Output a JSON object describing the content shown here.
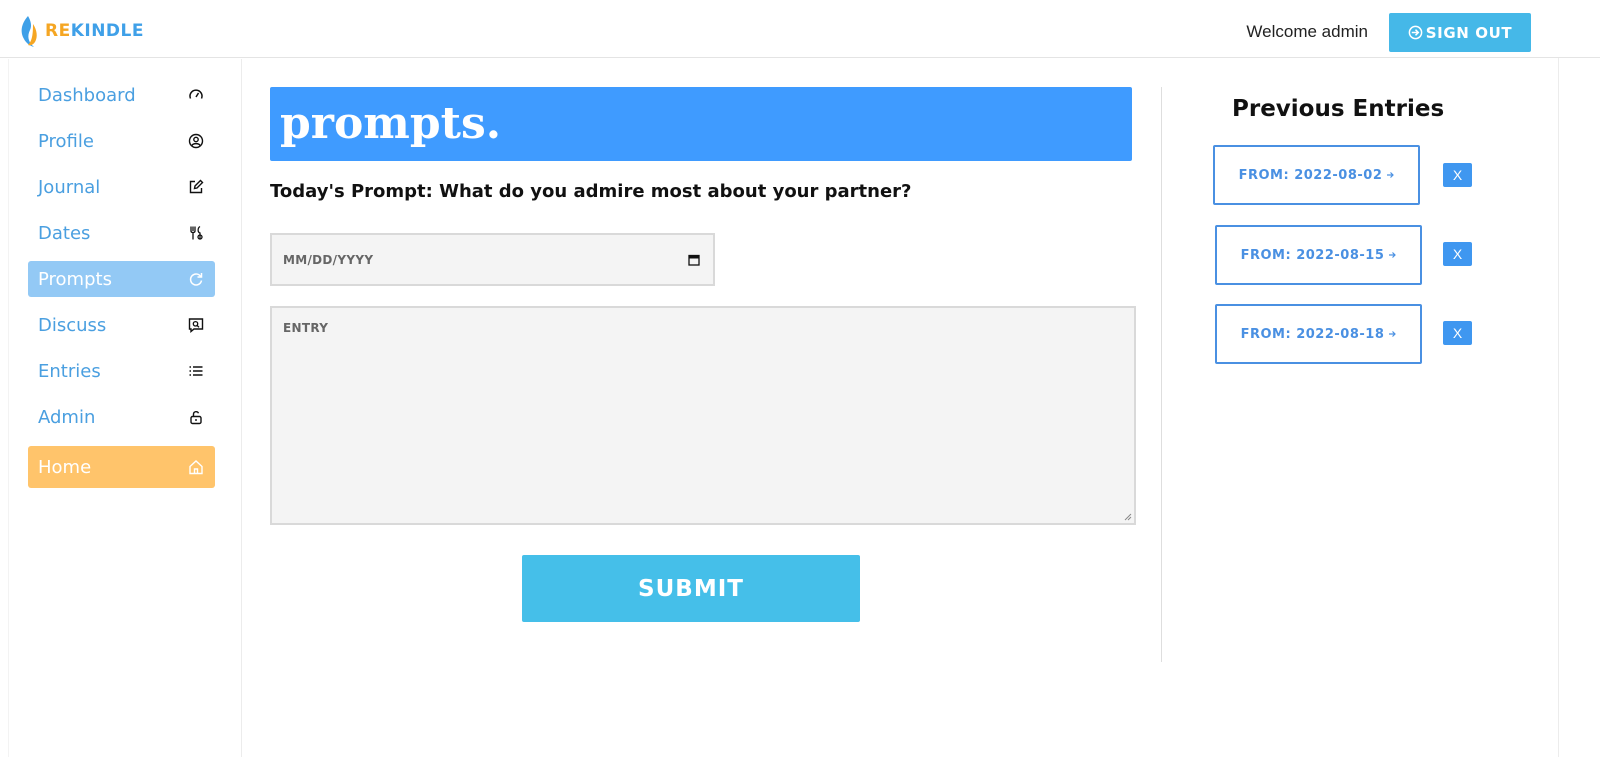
{
  "header": {
    "logo_re": "RE",
    "logo_kindle": "KINDLE",
    "welcome": "Welcome admin",
    "signout_label": "SIGN OUT"
  },
  "sidebar": {
    "items": [
      {
        "label": "Dashboard",
        "icon": "gauge-icon"
      },
      {
        "label": "Profile",
        "icon": "user-circle-icon"
      },
      {
        "label": "Journal",
        "icon": "edit-icon"
      },
      {
        "label": "Dates",
        "icon": "utensils-icon"
      },
      {
        "label": "Prompts",
        "icon": "refresh-icon",
        "active": true
      },
      {
        "label": "Discuss",
        "icon": "chat-search-icon"
      },
      {
        "label": "Entries",
        "icon": "list-icon"
      },
      {
        "label": "Admin",
        "icon": "lock-open-icon"
      },
      {
        "label": "Home",
        "icon": "home-icon"
      }
    ]
  },
  "main": {
    "banner_title": "prompts.",
    "prompt_text": "Today's Prompt: What do you admire most about your partner?",
    "date_placeholder": "MM/DD/YYYY",
    "entry_placeholder": "ENTRY",
    "submit_label": "SUBMIT"
  },
  "previous": {
    "title": "Previous Entries",
    "entries": [
      {
        "label": "FROM: 2022-08-02",
        "delete_label": "X"
      },
      {
        "label": "FROM: 2022-08-15",
        "delete_label": "X"
      },
      {
        "label": "FROM: 2022-08-18",
        "delete_label": "X"
      }
    ]
  },
  "colors": {
    "brand_blue": "#3f9bff",
    "brand_orange": "#f5a623",
    "accent_cyan": "#45b8e8",
    "active_nav": "#93c9f5",
    "home_nav": "#ffc46b"
  }
}
